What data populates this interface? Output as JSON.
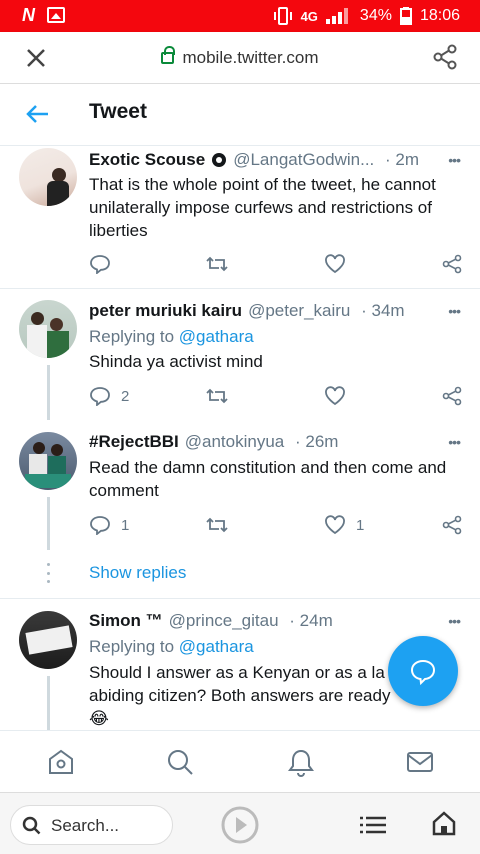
{
  "status_bar": {
    "network": "4G",
    "battery": "34%",
    "time": "18:06",
    "logo": "N"
  },
  "url_bar": {
    "url": "mobile.twitter.com"
  },
  "header": {
    "title": "Tweet"
  },
  "tweets": [
    {
      "name": "Exotic Scouse",
      "handle": "@LangatGodwin...",
      "time": "2m",
      "text": "That is the whole point of the tweet, he cannot unilaterally impose curfews and restrictions of liberties",
      "replies": "",
      "retweets": "",
      "likes": ""
    },
    {
      "name": "peter muriuki kairu",
      "handle": "@peter_kairu",
      "time": "34m",
      "replying_to": "Replying to",
      "replying_handle": "@gathara",
      "text": "Shinda ya activist mind",
      "replies": "2",
      "retweets": "",
      "likes": ""
    },
    {
      "name": "#RejectBBI",
      "handle": "@antokinyua",
      "time": "26m",
      "text": "Read the damn constitution and then come and comment",
      "replies": "1",
      "retweets": "",
      "likes": "1"
    },
    {
      "name": "Simon ™",
      "handle": "@prince_gitau",
      "time": "24m",
      "replying_to": "Replying to",
      "replying_handle": "@gathara",
      "text_line1": "Should I answer as a Kenyan or as a la",
      "text_line2": "abiding citizen? Both answers are ready",
      "emoji": "😂"
    }
  ],
  "show_replies": "Show replies",
  "browser_bar": {
    "search_placeholder": "Search..."
  },
  "colors": {
    "accent": "#1da1f2",
    "status_bar": "#f4070e",
    "muted": "#657786"
  }
}
